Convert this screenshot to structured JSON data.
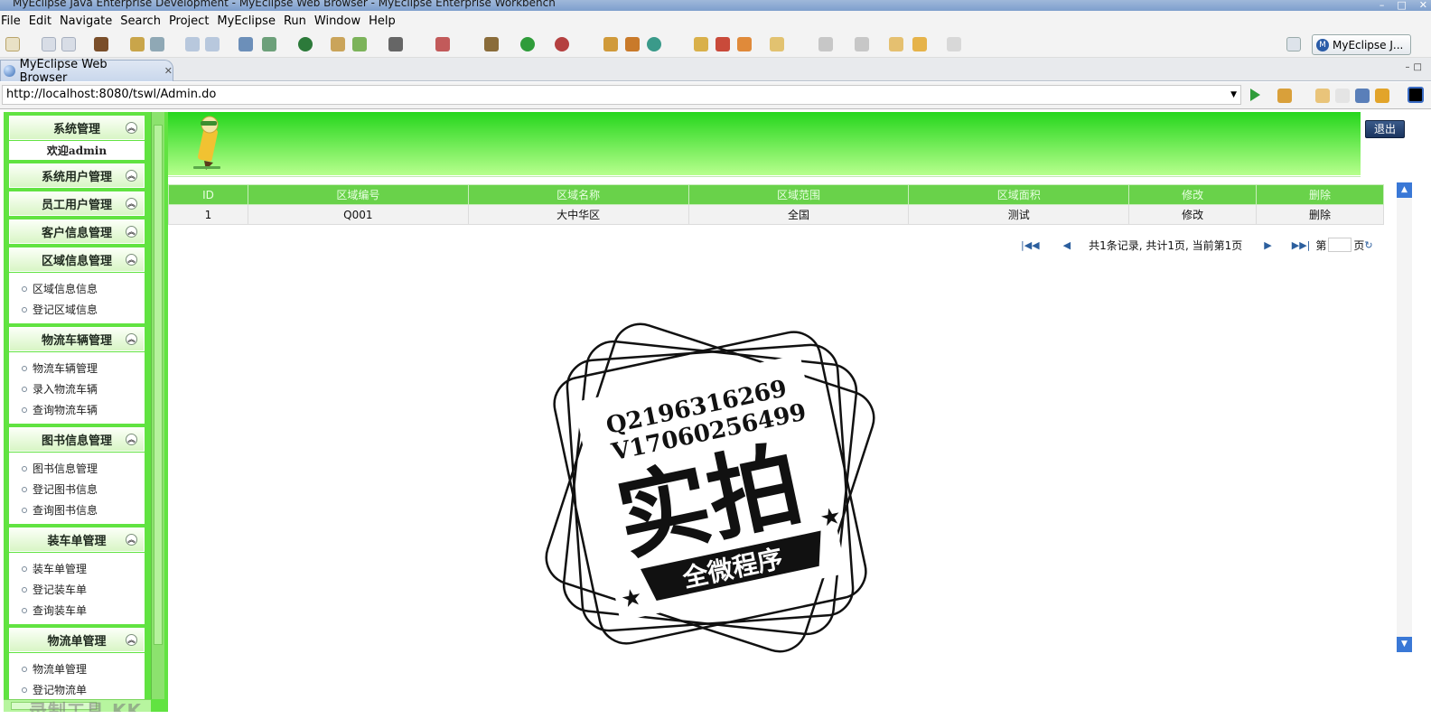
{
  "window": {
    "title": "MyEclipse Java Enterprise Development - MyEclipse Web Browser - MyEclipse Enterprise Workbench"
  },
  "menu": [
    "File",
    "Edit",
    "Navigate",
    "Search",
    "Project",
    "MyEclipse",
    "Run",
    "Window",
    "Help"
  ],
  "perspective": {
    "label": "MyEclipse J..."
  },
  "editor_tab": {
    "label": "MyEclipse Web Browser"
  },
  "browser": {
    "url": "http://localhost:8080/tswl/Admin.do"
  },
  "sidebar": {
    "welcome": "欢迎admin",
    "sections": [
      {
        "title": "系统管理",
        "items": []
      },
      {
        "title": "系统用户管理",
        "items": []
      },
      {
        "title": "员工用户管理",
        "items": []
      },
      {
        "title": "客户信息管理",
        "items": []
      },
      {
        "title": "区域信息管理",
        "items": [
          "区域信息信息",
          "登记区域信息"
        ]
      },
      {
        "title": "物流车辆管理",
        "items": [
          "物流车辆管理",
          "录入物流车辆",
          "查询物流车辆"
        ]
      },
      {
        "title": "图书信息管理",
        "items": [
          "图书信息管理",
          "登记图书信息",
          "查询图书信息"
        ]
      },
      {
        "title": "装车单管理",
        "items": [
          "装车单管理",
          "登记装车单",
          "查询装车单"
        ]
      },
      {
        "title": "物流单管理",
        "items": [
          "物流单管理",
          "登记物流单"
        ]
      }
    ]
  },
  "header": {
    "logout_label": "退出"
  },
  "table": {
    "columns": [
      "ID",
      "区域编号",
      "区域名称",
      "区域范围",
      "区域面积",
      "修改",
      "删除"
    ],
    "rows": [
      [
        "1",
        "Q001",
        "大中华区",
        "全国",
        "测试",
        "修改",
        "删除"
      ]
    ]
  },
  "pager": {
    "summary": "共1条记录, 共计1页, 当前第1页",
    "prefix": "第",
    "suffix": "页"
  },
  "watermark": {
    "line1": "Q2196316269",
    "line2": "V17060256499",
    "big": "实拍",
    "ribbon": "全微程序",
    "recorder": "录制工具 KK录像机"
  },
  "colors": {
    "nav_green": "#61e341",
    "banner_top": "#25d61c",
    "header_green": "#69d24a"
  }
}
